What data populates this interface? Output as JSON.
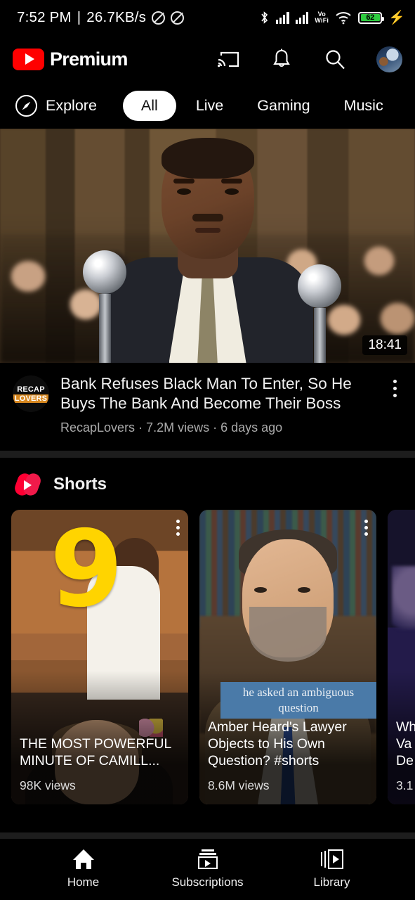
{
  "status_bar": {
    "time": "7:52 PM",
    "separator": "|",
    "network_speed": "26.7KB/s",
    "mute_icon_1": "no-symbol-icon",
    "mute_icon_2": "no-symbol-icon",
    "bluetooth_icon": "bluetooth-icon",
    "signal_1_icon": "signal-bars-icon",
    "signal_2_icon": "signal-bars-icon",
    "vowifi_line1": "Vo",
    "vowifi_line2": "WiFi",
    "wifi_icon": "wifi-icon",
    "battery_level": "62",
    "charging_icon": "charging-bolt-icon"
  },
  "header": {
    "logo_text": "Premium",
    "logo_icon": "youtube-play-icon",
    "cast_icon": "cast-icon",
    "notifications_icon": "bell-icon",
    "search_icon": "search-icon",
    "avatar_icon": "account-avatar"
  },
  "chips": {
    "explore": {
      "label": "Explore",
      "icon": "compass-icon"
    },
    "items": [
      {
        "label": "All",
        "selected": true
      },
      {
        "label": "Live",
        "selected": false
      },
      {
        "label": "Gaming",
        "selected": false
      },
      {
        "label": "Music",
        "selected": false
      }
    ]
  },
  "video": {
    "duration": "18:41",
    "title": "Bank Refuses Black Man To Enter, So He Buys The Bank And Become Their Boss",
    "channel_avatar_line1": "RECAP",
    "channel_avatar_line2": "LOVERS",
    "channel_avatar_highlight": "#d78820",
    "subtitle": "RecapLovers · 7.2M views · 6 days ago",
    "menu_icon": "kebab-menu-icon"
  },
  "shorts": {
    "section_title": "Shorts",
    "logo_icon": "shorts-icon",
    "items": [
      {
        "title": "THE MOST POWERFUL MINUTE OF CAMILL...",
        "views": "98K views",
        "overlay_number": "9",
        "menu_icon": "kebab-menu-icon"
      },
      {
        "title": "Amber Heard's Lawyer Objects to His Own Question? #shorts",
        "views": "8.6M views",
        "caption": "he asked an ambiguous question",
        "menu_icon": "kebab-menu-icon"
      },
      {
        "title_line1": "Wh",
        "title_line2": "Va",
        "title_line3": "De",
        "views": "3.1"
      }
    ]
  },
  "bottom_nav": {
    "items": [
      {
        "label": "Home",
        "icon": "home-icon",
        "active": true
      },
      {
        "label": "Subscriptions",
        "icon": "subscriptions-icon",
        "active": false
      },
      {
        "label": "Library",
        "icon": "library-icon",
        "active": false
      }
    ]
  },
  "colors": {
    "brand_red": "#ff0000",
    "shorts_red": "#ff0033",
    "background": "#000000",
    "divider": "#1d1d1d",
    "secondary_text": "#aaaaaa"
  }
}
